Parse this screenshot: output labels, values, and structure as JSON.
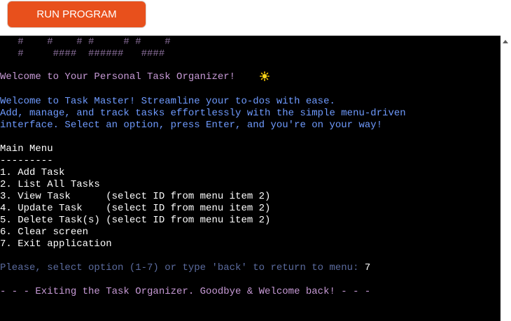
{
  "toolbar": {
    "run_label": "RUN PROGRAM"
  },
  "terminal": {
    "banner_1": "   #    #    # #     # #    #",
    "banner_2": "   #     ####  ######   ####",
    "welcome_title": "Welcome to Your Personal Task Organizer! ",
    "intro_1": "Welcome to Task Master! Streamline your to-dos with ease.",
    "intro_2": "Add, manage, and track tasks effortlessly with the simple menu-driven",
    "intro_3": "interface. Select an option, press Enter, and you're on your way!",
    "menu_title": "Main Menu",
    "menu_rule": "---------",
    "menu_items": [
      "1. Add Task",
      "2. List All Tasks",
      "3. View Task      (select ID from menu item 2)",
      "4. Update Task    (select ID from menu item 2)",
      "5. Delete Task(s) (select ID from menu item 2)",
      "6. Clear screen",
      "7. Exit application"
    ],
    "prompt": "Please, select option (1-7) or type 'back' to return to menu: ",
    "input_value": "7",
    "goodbye": "- - - Exiting the Task Organizer. Goodbye & Welcome back! - - -"
  },
  "icons": {
    "emoji": "sun-icon",
    "scroll": "scroll-up-arrow-icon"
  },
  "colors": {
    "run_button": "#e8501c",
    "terminal_bg": "#000000",
    "accent_text": "#c79ad6",
    "info_text": "#6f9bff",
    "prompt_text": "#5b6b9e"
  }
}
